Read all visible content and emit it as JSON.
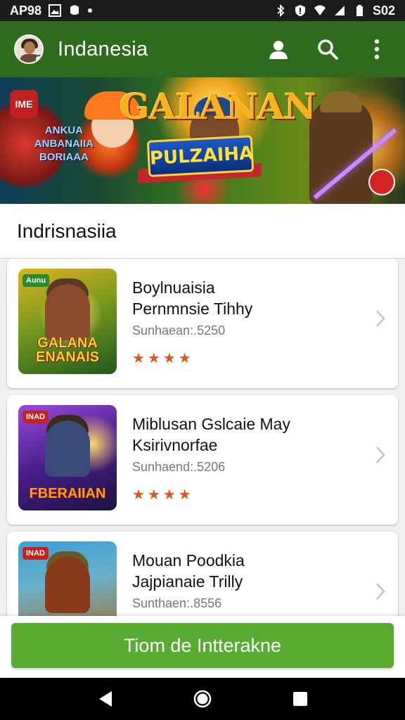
{
  "status_bar": {
    "left_text": "AP98",
    "right_text": "S02"
  },
  "app_bar": {
    "title": "Indanesia"
  },
  "banner": {
    "badge": "IME",
    "small_text": "ANKUA ANBANAIIA BORIAAA",
    "title": "GALANAN",
    "subtitle": "PULZAIHA"
  },
  "section": {
    "title": "Indrisnasiia"
  },
  "items": [
    {
      "name_line1": "Boylnuaisia",
      "name_line2": "Pernmnsie Tihhy",
      "meta": "Sunhaean:.5250",
      "stars": "★★★★",
      "thumb_tag": "Aunu",
      "thumb_caption": "GALANA ENANAIS",
      "thumb_color_top": "#d9a514",
      "thumb_color_bottom": "#1f5a1d"
    },
    {
      "name_line1": "Miblusan Gslcaie May",
      "name_line2": "Ksirivnorfae",
      "meta": "Sunhaend:.5206",
      "stars": "★★★★",
      "thumb_tag": "INAD",
      "thumb_caption": "FBERAIIAN",
      "thumb_color_top": "#7a3bd1",
      "thumb_color_bottom": "#1a1240"
    },
    {
      "name_line1": "Mouan Poodkia",
      "name_line2": "Jajpianaie Trilly",
      "meta": "Sunthaen:.8556",
      "stars": "★★★★",
      "thumb_tag": "INAD",
      "thumb_caption": "",
      "thumb_color_top": "#3aa0d8",
      "thumb_color_bottom": "#a86a20"
    }
  ],
  "cta": {
    "label": "Tiom de Intterakne"
  },
  "colors": {
    "app_bar": "#2e6b1f",
    "cta": "#5aab32",
    "stars": "#e2531b"
  }
}
